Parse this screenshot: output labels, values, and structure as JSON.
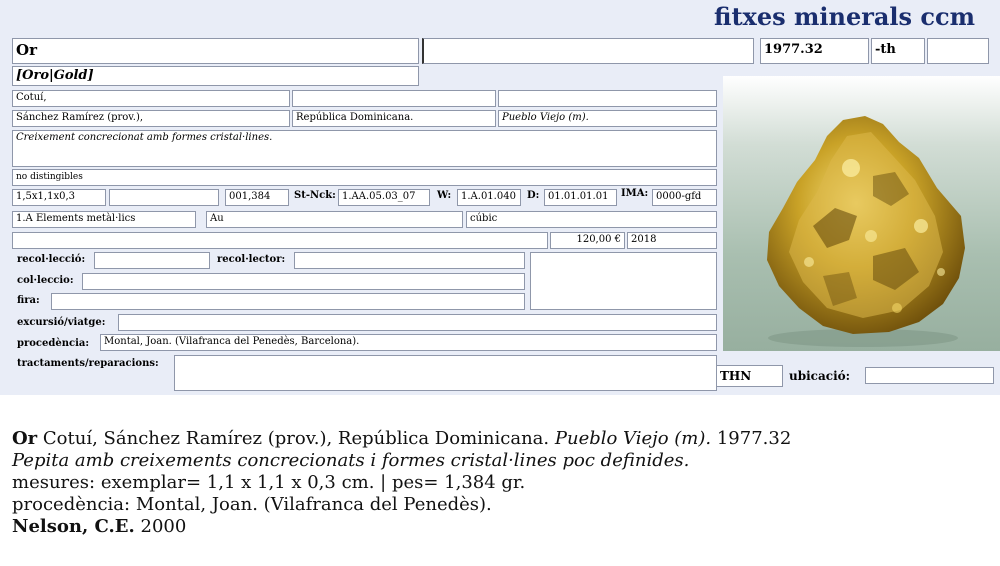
{
  "header": {
    "title": "fitxes minerals ccm"
  },
  "record": {
    "name": "Or",
    "field2": "",
    "catalog": "1977.32",
    "suffix": "-th",
    "extra": "",
    "synonyms": "[Oro|Gold]",
    "locality": "Cotuí,",
    "loc2": "",
    "loc3": "",
    "province": "Sánchez Ramírez (prov.),",
    "country": "República Dominicana.",
    "mine": "Pueblo Viejo (m).",
    "habit": "Creixement concrecionat amb formes cristal·lines.",
    "associated": "no distingibles",
    "dims": "1,5x1,1x0,3",
    "dims2": "",
    "weight": "001,384",
    "stnck_label": "St-Nck:",
    "stnck": "1.AA.05.03_07",
    "w_label": "W:",
    "w": "1.A.01.040",
    "d_label": "D:",
    "d": "01.01.01.01",
    "ima_label": "IMA:",
    "ima": "0000-gfd",
    "class": "1.A Elements metàl·lics",
    "formula": "Au",
    "system": "cúbic",
    "row9a": "",
    "price": "120,00 €",
    "year": "2018"
  },
  "labels": {
    "recoleccio": "recol·lecció:",
    "recolector": "recol·lector:",
    "colleccio": "col·leccio:",
    "fira": "fira:",
    "excursio": "excursió/viatge:",
    "procedencia": "procedència:",
    "tractaments": "tractaments/reparacions:",
    "ubicacio": "ubicació:"
  },
  "values": {
    "recoleccio": "",
    "recolector": "",
    "colleccio": "",
    "fira": "",
    "notes": "",
    "excursio": "",
    "procedencia": "Montal, Joan. (Vilafranca del Penedès, Barcelona).",
    "tractaments": "",
    "thn": "THN",
    "ubicacio": ""
  },
  "photo": {
    "subject": "gold-nugget",
    "colors": {
      "gold": "#c9a227",
      "dark": "#5e4408",
      "bright": "#f6df7a"
    }
  },
  "description": {
    "name": "Or",
    "locality": "Cotuí, Sánchez Ramírez (prov.), República Dominicana.",
    "mine": "Pueblo Viejo (m).",
    "catalog": "1977.32",
    "habit": "Pepita amb creixements concrecionats i formes cristal·lines poc definides.",
    "measures": "mesures: exemplar= 1,1 x 1,1 x 0,3 cm. | pes= 1,384 gr.",
    "procedencia": "procedència: Montal, Joan. (Vilafranca del Penedès).",
    "author": "Nelson, C.E.",
    "author_year": "2000"
  }
}
